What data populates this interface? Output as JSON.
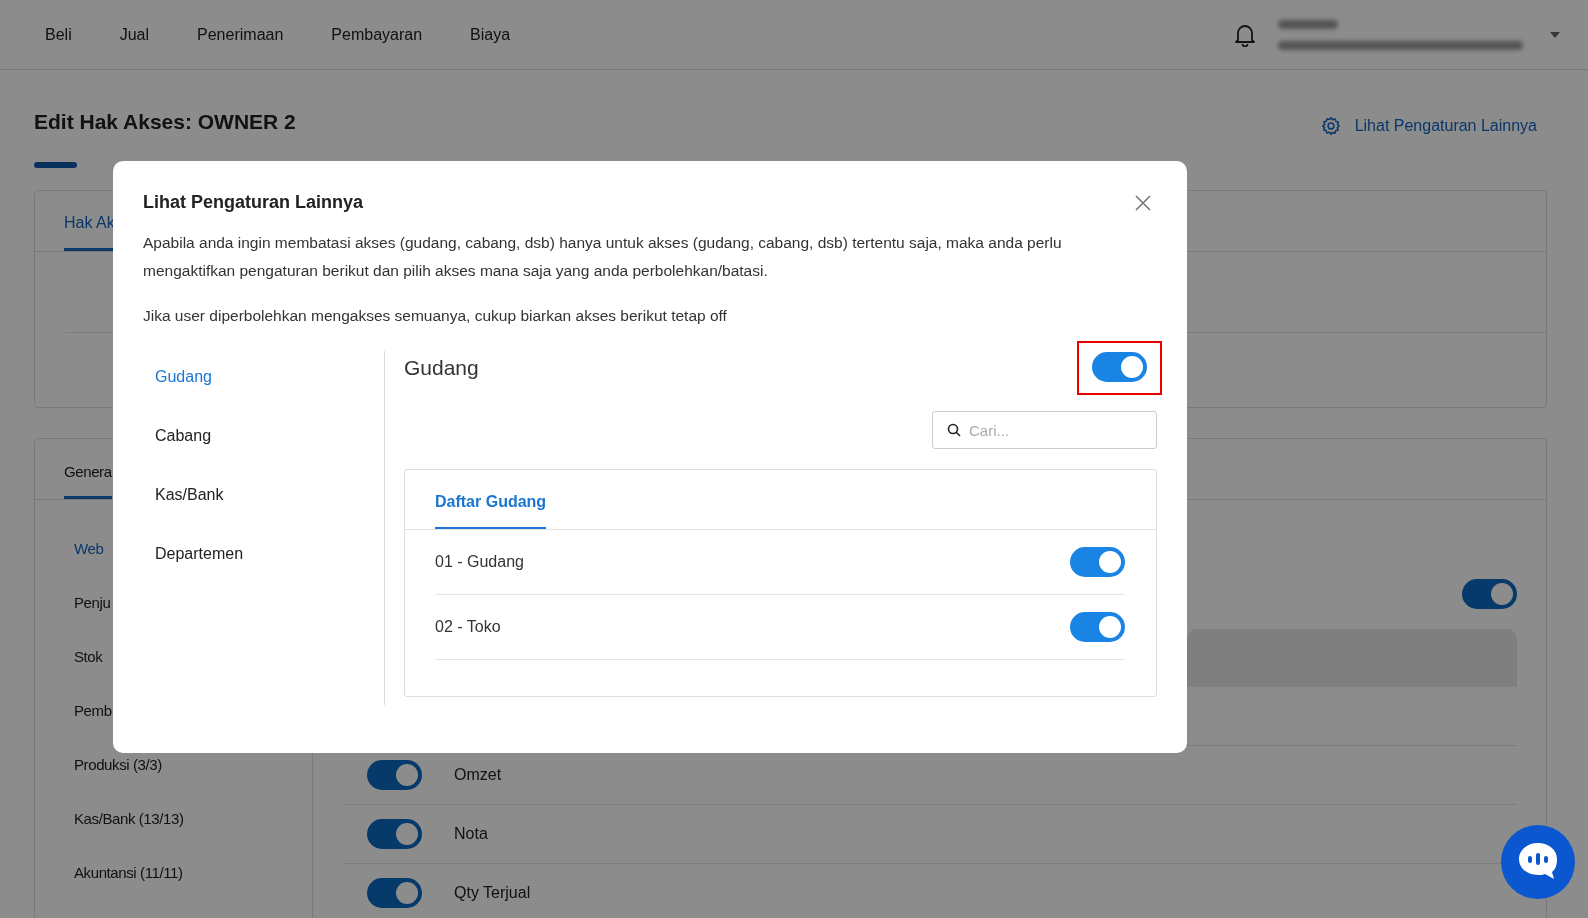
{
  "nav": {
    "items": [
      "Beli",
      "Jual",
      "Penerimaan",
      "Pembayaran",
      "Biaya"
    ]
  },
  "header": {
    "title": "Edit Hak Akses: OWNER 2",
    "settings_link": "Lihat Pengaturan Lainnya"
  },
  "access_card": {
    "tab": "Hak Ak"
  },
  "general_card": {
    "tab": "Genera",
    "sidebar": [
      {
        "label": "Web",
        "selected": true
      },
      {
        "label": "Penju",
        "selected": false
      },
      {
        "label": "Stok",
        "selected": false
      },
      {
        "label": "Pemb",
        "selected": false
      },
      {
        "label": "Produksi (3/3)",
        "selected": false
      },
      {
        "label": "Kas/Bank (13/13)",
        "selected": false
      },
      {
        "label": "Akuntansi (11/11)",
        "selected": false
      }
    ],
    "toggle": {
      "on": true
    },
    "rows": [
      {
        "label": "Omzet",
        "on": true
      },
      {
        "label": "Nota",
        "on": true
      },
      {
        "label": "Qty Terjual",
        "on": true
      }
    ]
  },
  "modal": {
    "title": "Lihat Pengaturan Lainnya",
    "description": "Apabila anda ingin membatasi akses (gudang, cabang, dsb) hanya untuk akses (gudang, cabang, dsb) tertentu saja, maka anda perlu mengaktifkan pengaturan berikut dan pilih akses mana saja yang anda perbolehkan/batasi.",
    "note": "Jika user diperbolehkan mengakses semuanya, cukup biarkan akses berikut tetap off",
    "menu": [
      {
        "label": "Gudang",
        "selected": true
      },
      {
        "label": "Cabang",
        "selected": false
      },
      {
        "label": "Kas/Bank",
        "selected": false
      },
      {
        "label": "Departemen",
        "selected": false
      }
    ],
    "section": {
      "title": "Gudang",
      "on": true,
      "highlighted": true
    },
    "search": {
      "placeholder": "Cari..."
    },
    "list_tab": {
      "label": "Daftar Gudang",
      "selected": true
    },
    "items": [
      {
        "label": "01 - Gudang",
        "on": true
      },
      {
        "label": "02 - Toko",
        "on": true
      }
    ]
  }
}
